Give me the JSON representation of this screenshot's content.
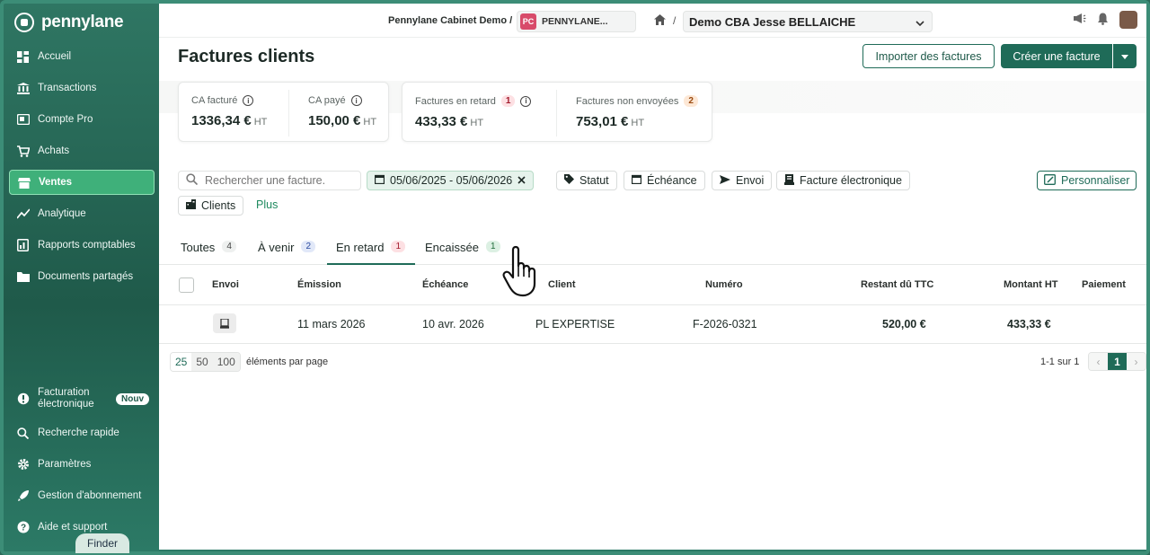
{
  "colors": {
    "brand": "#1f6b58",
    "sidebar": "#245f4f",
    "active_nav": "#3fb07a"
  },
  "sidebar": {
    "brand": "pennylane",
    "items": [
      {
        "label": "Accueil",
        "icon": "dashboard-icon"
      },
      {
        "label": "Transactions",
        "icon": "bank-icon"
      },
      {
        "label": "Compte Pro",
        "icon": "card-icon"
      },
      {
        "label": "Achats",
        "icon": "cart-icon"
      },
      {
        "label": "Ventes",
        "icon": "store-icon",
        "active": true
      },
      {
        "label": "Analytique",
        "icon": "chart-line-icon"
      },
      {
        "label": "Rapports comptables",
        "icon": "reports-icon"
      },
      {
        "label": "Documents partagés",
        "icon": "folder-icon"
      }
    ],
    "bottom": [
      {
        "label": "Facturation électronique",
        "badge": "Nouv",
        "icon": "e-invoice-icon"
      },
      {
        "label": "Recherche rapide",
        "icon": "search-icon"
      },
      {
        "label": "Paramètres",
        "icon": "gear-icon"
      },
      {
        "label": "Gestion d'abonnement",
        "icon": "rocket-icon"
      },
      {
        "label": "Aide et support",
        "icon": "help-icon"
      }
    ],
    "finder": "Finder"
  },
  "topbar": {
    "cabinet": "Pennylane Cabinet Demo",
    "separator": "/",
    "org_badge": "PC",
    "org_name": "PENNYLANE...",
    "company": "Demo CBA Jesse BELLAICHE"
  },
  "page": {
    "title": "Factures clients",
    "import_button": "Importer des factures",
    "create_button": "Créer une facture"
  },
  "kpis": [
    {
      "label": "CA facturé",
      "value": "1336,34 €",
      "unit": "HT"
    },
    {
      "label": "CA payé",
      "value": "150,00 €",
      "unit": "HT"
    },
    {
      "label": "Factures en retard",
      "count": "1",
      "value": "433,33 €",
      "unit": "HT"
    },
    {
      "label": "Factures non envoyées",
      "count": "2",
      "value": "753,01 €",
      "unit": "HT"
    }
  ],
  "filters": {
    "search_placeholder": "Rechercher une facture.",
    "date_range": "05/06/2025 - 05/06/2026",
    "statut": "Statut",
    "echeance": "Échéance",
    "envoi": "Envoi",
    "facture_electronique": "Facture électronique",
    "clients": "Clients",
    "plus": "Plus",
    "personnaliser": "Personnaliser"
  },
  "tabs": [
    {
      "label": "Toutes",
      "count": "4"
    },
    {
      "label": "À venir",
      "count": "2"
    },
    {
      "label": "En retard",
      "count": "1",
      "active": true
    },
    {
      "label": "Encaissée",
      "count": "1"
    }
  ],
  "table": {
    "columns": [
      "Envoi",
      "Émission",
      "Échéance",
      "Client",
      "Numéro",
      "Restant dû TTC",
      "Montant HT",
      "Paiement"
    ],
    "rows": [
      {
        "emission": "11 mars 2026",
        "echeance": "10 avr. 2026",
        "client": "PL EXPERTISE",
        "numero": "F-2026-0321",
        "restant_du": "520,00 €",
        "montant_ht": "433,33 €"
      }
    ]
  },
  "pagination": {
    "sizes": [
      "25",
      "50",
      "100"
    ],
    "per_page_label": "éléments par page",
    "range": "1-1 sur 1",
    "current_page": "1"
  }
}
